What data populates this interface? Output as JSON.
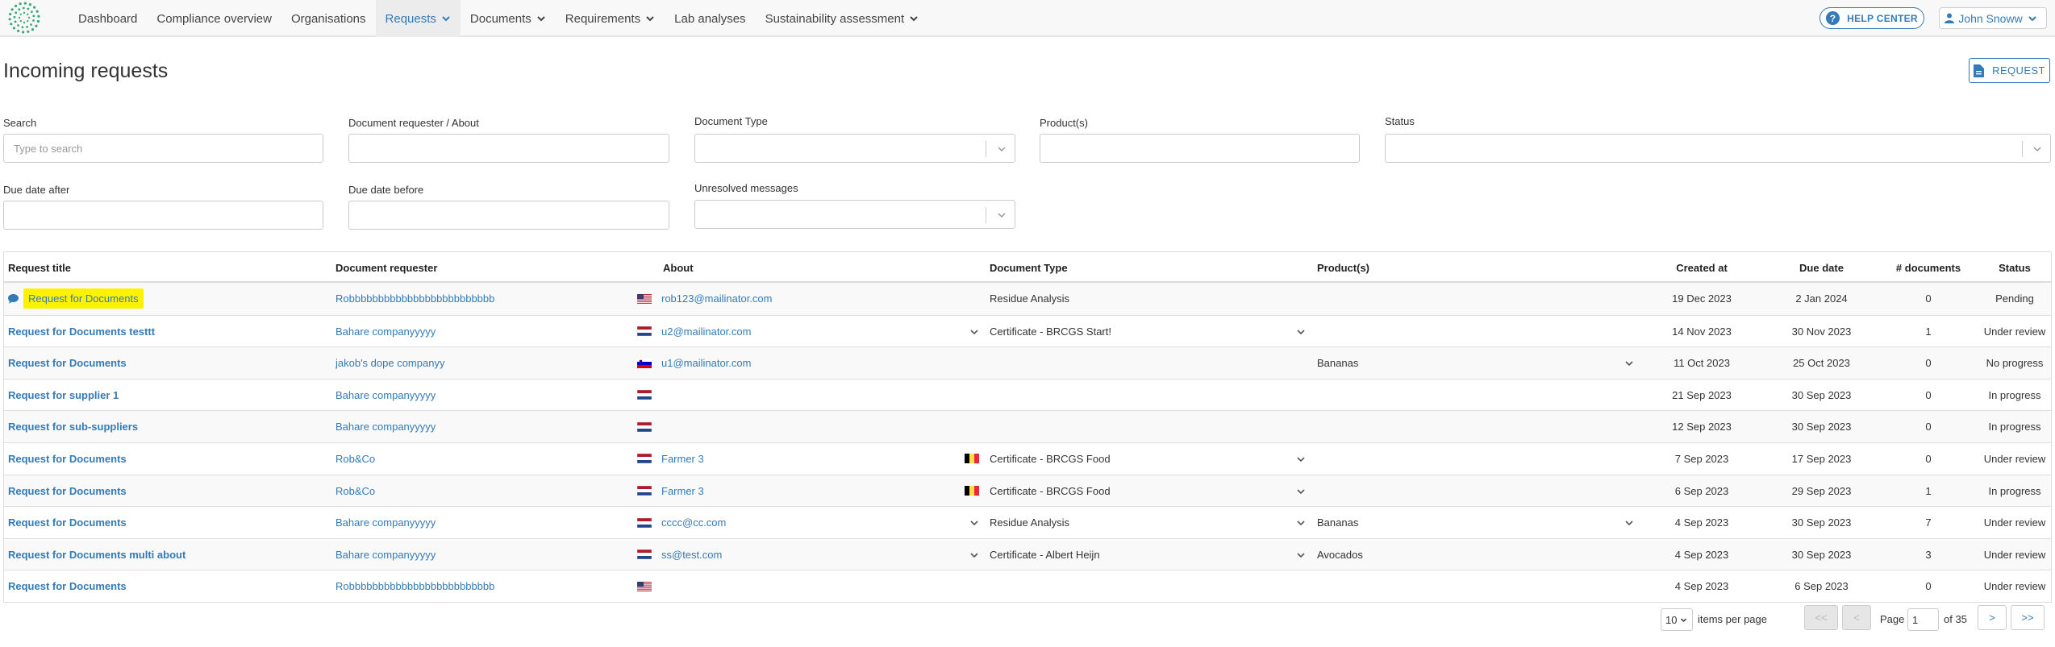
{
  "nav": {
    "items": [
      {
        "label": "Dashboard",
        "dropdown": false
      },
      {
        "label": "Compliance overview",
        "dropdown": false
      },
      {
        "label": "Organisations",
        "dropdown": false
      },
      {
        "label": "Requests",
        "dropdown": true,
        "active": true
      },
      {
        "label": "Documents",
        "dropdown": true
      },
      {
        "label": "Requirements",
        "dropdown": true
      },
      {
        "label": "Lab analyses",
        "dropdown": false
      },
      {
        "label": "Sustainability assessment",
        "dropdown": true
      }
    ],
    "help_label": "HELP CENTER",
    "user_label": "John Snoww"
  },
  "page": {
    "title": "Incoming requests",
    "request_button": "REQUEST"
  },
  "filters": {
    "search_label": "Search",
    "search_placeholder": "Type to search",
    "requester_label": "Document requester / About",
    "doctype_label": "Document Type",
    "products_label": "Product(s)",
    "status_label": "Status",
    "due_after_label": "Due date after",
    "due_before_label": "Due date before",
    "unresolved_label": "Unresolved messages"
  },
  "table": {
    "headers": {
      "title": "Request title",
      "requester": "Document requester",
      "about": "About",
      "doctype": "Document Type",
      "products": "Product(s)",
      "created": "Created at",
      "due": "Due date",
      "docs": "# documents",
      "status": "Status"
    },
    "rows": [
      {
        "title": "Request for Documents",
        "highlight": true,
        "chat": true,
        "requester": "Robbbbbbbbbbbbbbbbbbbbbbbbb",
        "about_flag": "us",
        "about": "rob123@mailinator.com",
        "about_more": false,
        "doc_flag": "",
        "doctype": "Residue Analysis",
        "doctype_more": false,
        "products": "",
        "products_more": false,
        "created": "19 Dec 2023",
        "due": "2 Jan 2024",
        "docs": "0",
        "status": "Pending"
      },
      {
        "title": "Request for Documents testtt",
        "highlight": false,
        "chat": false,
        "requester": "Bahare companyyyyy",
        "about_flag": "nl",
        "about": "u2@mailinator.com",
        "about_more": true,
        "doc_flag": "",
        "doctype": "Certificate - BRCGS Start!",
        "doctype_more": true,
        "products": "",
        "products_more": false,
        "created": "14 Nov 2023",
        "due": "30 Nov 2023",
        "docs": "1",
        "status": "Under review"
      },
      {
        "title": "Request for Documents",
        "highlight": false,
        "chat": false,
        "requester": "jakob's dope companyy",
        "about_flag": "si",
        "about": "u1@mailinator.com",
        "about_more": false,
        "doc_flag": "",
        "doctype": "",
        "doctype_more": false,
        "products": "Bananas",
        "products_more": true,
        "created": "11 Oct 2023",
        "due": "25 Oct 2023",
        "docs": "0",
        "status": "No progress"
      },
      {
        "title": "Request for supplier 1",
        "highlight": false,
        "chat": false,
        "requester": "Bahare companyyyyy",
        "about_flag": "nl",
        "about": "",
        "about_more": false,
        "doc_flag": "",
        "doctype": "",
        "doctype_more": false,
        "products": "",
        "products_more": false,
        "created": "21 Sep 2023",
        "due": "30 Sep 2023",
        "docs": "0",
        "status": "In progress"
      },
      {
        "title": "Request for sub-suppliers",
        "highlight": false,
        "chat": false,
        "requester": "Bahare companyyyyy",
        "about_flag": "nl",
        "about": "",
        "about_more": false,
        "doc_flag": "",
        "doctype": "",
        "doctype_more": false,
        "products": "",
        "products_more": false,
        "created": "12 Sep 2023",
        "due": "30 Sep 2023",
        "docs": "0",
        "status": "In progress"
      },
      {
        "title": "Request for Documents",
        "highlight": false,
        "chat": false,
        "requester": "Rob&Co",
        "about_flag": "nl",
        "about": "Farmer 3",
        "about_more": false,
        "doc_flag": "be",
        "doctype": "Certificate - BRCGS Food",
        "doctype_more": true,
        "products": "",
        "products_more": false,
        "created": "7 Sep 2023",
        "due": "17 Sep 2023",
        "docs": "0",
        "status": "Under review"
      },
      {
        "title": "Request for Documents",
        "highlight": false,
        "chat": false,
        "requester": "Rob&Co",
        "about_flag": "nl",
        "about": "Farmer 3",
        "about_more": false,
        "doc_flag": "be",
        "doctype": "Certificate - BRCGS Food",
        "doctype_more": true,
        "products": "",
        "products_more": false,
        "created": "6 Sep 2023",
        "due": "29 Sep 2023",
        "docs": "1",
        "status": "In progress"
      },
      {
        "title": "Request for Documents",
        "highlight": false,
        "chat": false,
        "requester": "Bahare companyyyyy",
        "about_flag": "nl",
        "about": "cccc@cc.com",
        "about_more": true,
        "doc_flag": "",
        "doctype": "Residue Analysis",
        "doctype_more": true,
        "products": "Bananas",
        "products_more": true,
        "created": "4 Sep 2023",
        "due": "30 Sep 2023",
        "docs": "7",
        "status": "Under review"
      },
      {
        "title": "Request for Documents multi about",
        "highlight": false,
        "chat": false,
        "requester": "Bahare companyyyyy",
        "about_flag": "nl",
        "about": "ss@test.com",
        "about_more": true,
        "doc_flag": "",
        "doctype": "Certificate - Albert Heijn",
        "doctype_more": true,
        "products": "Avocados",
        "products_more": false,
        "created": "4 Sep 2023",
        "due": "30 Sep 2023",
        "docs": "3",
        "status": "Under review"
      },
      {
        "title": "Request for Documents",
        "highlight": false,
        "chat": false,
        "requester": "Robbbbbbbbbbbbbbbbbbbbbbbbb",
        "about_flag": "us",
        "about": "",
        "about_more": false,
        "doc_flag": "",
        "doctype": "",
        "doctype_more": false,
        "products": "",
        "products_more": false,
        "created": "4 Sep 2023",
        "due": "6 Sep 2023",
        "docs": "0",
        "status": "Under review"
      }
    ]
  },
  "pagination": {
    "per_page": "10",
    "per_page_label": "items per page",
    "first": "<<",
    "prev": "<",
    "page_label": "Page",
    "current_page": "1",
    "of_label": "of 35",
    "next": ">",
    "last": ">>"
  },
  "colors": {
    "link": "#337ab7",
    "highlight": "#fff200"
  }
}
